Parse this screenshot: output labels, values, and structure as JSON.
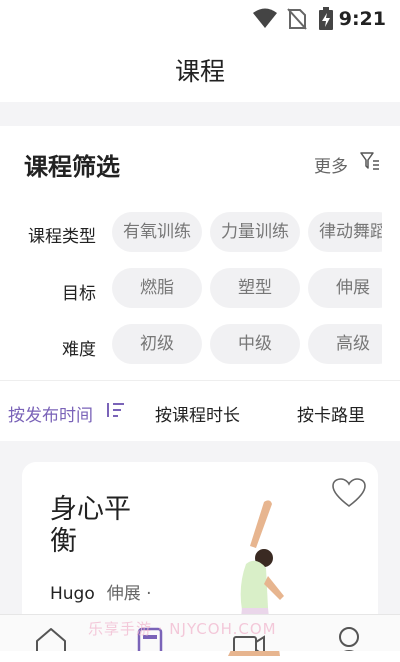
{
  "status_bar": {
    "time": "9:21",
    "icons": [
      "wifi-icon",
      "no-sim-icon",
      "battery-charging-icon"
    ]
  },
  "header": {
    "title": "课程"
  },
  "filter": {
    "title": "课程筛选",
    "more_label": "更多",
    "rows": [
      {
        "label": "课程类型",
        "options": [
          "有氧训练",
          "力量训练",
          "律动舞蹈"
        ]
      },
      {
        "label": "目标",
        "options": [
          "燃脂",
          "塑型",
          "伸展"
        ]
      },
      {
        "label": "难度",
        "options": [
          "初级",
          "中级",
          "高级"
        ]
      }
    ]
  },
  "sort": {
    "options": [
      "按发布时间",
      "按课程时长",
      "按卡路里"
    ],
    "active": "按发布时间"
  },
  "card": {
    "title": "身心平衡",
    "coach": "Hugo",
    "tags": "伸展 ·"
  },
  "tabbar": {
    "icons": [
      "home-icon",
      "course-icon",
      "video-icon",
      "profile-icon"
    ]
  },
  "watermark": "乐享手游 · NJYCOH.COM",
  "colors": {
    "accent": "#7a63b8",
    "chip_bg": "#f1f1f3",
    "page_bg": "#f4f4f6"
  }
}
